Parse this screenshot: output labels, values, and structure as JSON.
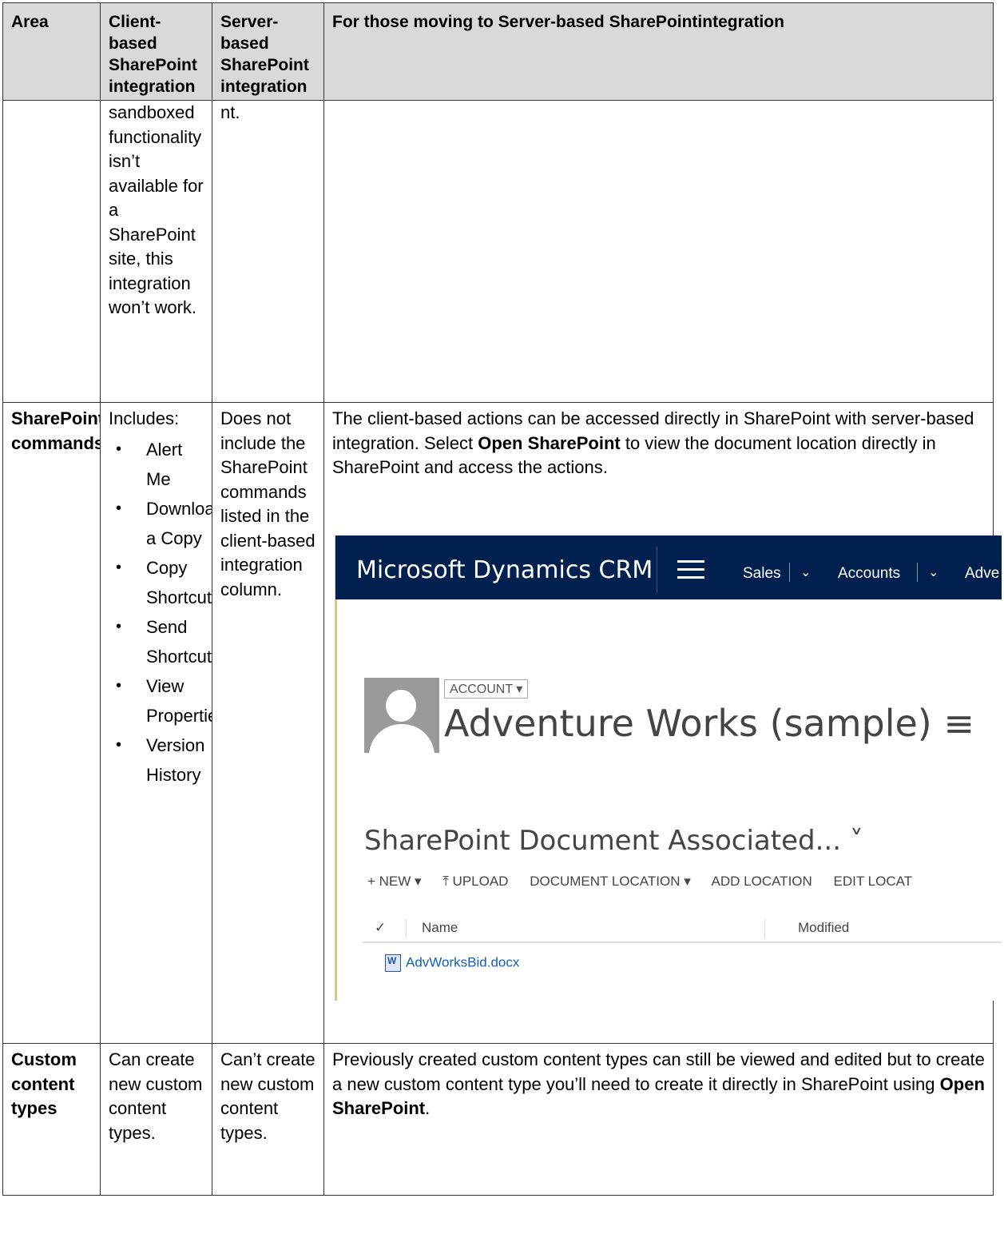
{
  "table": {
    "headers": [
      "Area",
      "Client-based SharePoint integration",
      "Server-based SharePoint integration",
      "For those moving to Server-based SharePointintegration"
    ],
    "continued_row": {
      "area": "",
      "client": "sandboxed functionality isn’t available for a SharePoint site, this integration won’t work.",
      "server": "nt.",
      "moving": ""
    },
    "commands_row": {
      "area": "SharePoint commands",
      "client_intro": "Includes:",
      "client_items": [
        "Alert Me",
        "Download a Copy",
        "Copy Shortcut",
        "Send Shortcut",
        "View Properties",
        "Version History"
      ],
      "server": "Does not include the SharePoint commands listed in the client-based integration column.",
      "moving_before": "The client-based actions can be accessed directly in SharePoint with server-based integration. Select ",
      "moving_bold": "Open SharePoint",
      "moving_after": " to view the document location directly in SharePoint and access the actions."
    },
    "content_types_row": {
      "area": "Custom content types",
      "client": "Can create new custom content types.",
      "server": "Can’t create new custom content types.",
      "moving_before": "Previously created custom content types can still be viewed and edited but to create a new custom content type you’ll need to create it directly in SharePoint using ",
      "moving_bold": "Open SharePoint",
      "moving_after": "."
    }
  },
  "screenshot": {
    "brand": "Microsoft Dynamics CRM",
    "nav": [
      "Sales",
      "Accounts",
      "Adve"
    ],
    "entity_badge": "ACCOUNT ▾",
    "record_name": "Adventure Works (sample) ≡",
    "section_title": "SharePoint Document Associated...  ˅",
    "toolbar": [
      "+ NEW ▾",
      "⤒ UPLOAD",
      "DOCUMENT LOCATION ▾",
      "ADD LOCATION",
      "EDIT LOCAT"
    ],
    "columns": [
      "Name",
      "Modified"
    ],
    "file": "AdvWorksBid.docx",
    "colors": {
      "navbar": "#002050",
      "link": "#1160b7",
      "header_bg": "#d9d9d9"
    }
  }
}
